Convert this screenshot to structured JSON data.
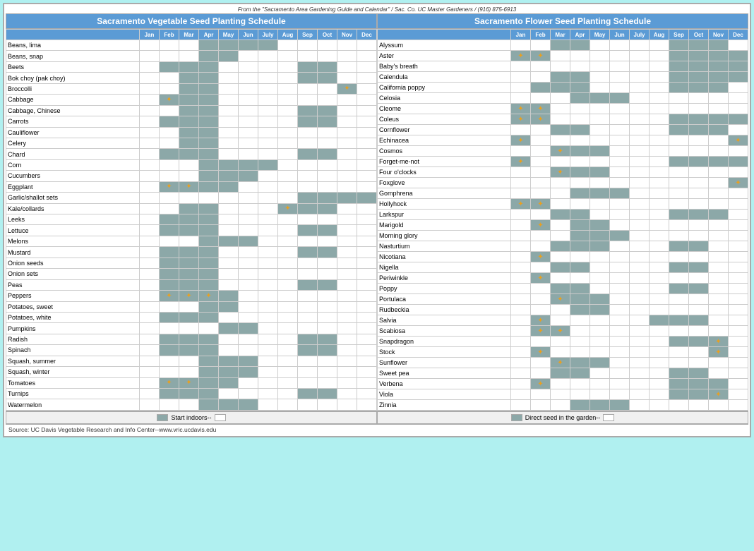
{
  "title": "Sacramento Area Gardening Guide and Calendar",
  "source_header": "From the \"Sacramento Area Gardening Guide and Calendar\" / Sac. Co. UC Master Gardeners / (916) 875-6913",
  "veg_title": "Sacramento Vegetable Seed Planting Schedule",
  "flower_title": "Sacramento Flower Seed Planting Schedule",
  "months": [
    "Jan",
    "Feb",
    "Mar",
    "Apr",
    "May",
    "Jun",
    "July",
    "Aug",
    "Sep",
    "Oct",
    "Nov",
    "Dec"
  ],
  "footer_left": "Start indoors--",
  "footer_right": "Direct seed in the garden--",
  "source_text": "Source:  UC Davis Vegetable Research and Info Center--www.vric.ucdavis.edu",
  "vegetables": [
    {
      "name": "Beans, lima",
      "months": [
        0,
        0,
        0,
        1,
        1,
        1,
        1,
        0,
        0,
        0,
        0,
        0
      ]
    },
    {
      "name": "Beans, snap",
      "months": [
        0,
        0,
        0,
        1,
        1,
        0,
        0,
        0,
        0,
        0,
        0,
        0
      ]
    },
    {
      "name": "Beets",
      "months": [
        0,
        1,
        1,
        1,
        0,
        0,
        0,
        0,
        1,
        1,
        0,
        0
      ]
    },
    {
      "name": "Bok choy (pak choy)",
      "months": [
        0,
        0,
        1,
        1,
        0,
        0,
        0,
        0,
        1,
        1,
        0,
        0
      ]
    },
    {
      "name": "Broccolli",
      "months": [
        0,
        0,
        1,
        1,
        0,
        0,
        0,
        0,
        0,
        0,
        "*",
        0
      ]
    },
    {
      "name": "Cabbage",
      "months": [
        0,
        "*",
        1,
        1,
        0,
        0,
        0,
        0,
        0,
        0,
        0,
        0
      ]
    },
    {
      "name": "Cabbage, Chinese",
      "months": [
        0,
        0,
        1,
        1,
        0,
        0,
        0,
        0,
        1,
        1,
        0,
        0
      ]
    },
    {
      "name": "Carrots",
      "months": [
        0,
        1,
        1,
        1,
        0,
        0,
        0,
        0,
        1,
        1,
        0,
        0
      ]
    },
    {
      "name": "Cauliflower",
      "months": [
        0,
        0,
        1,
        1,
        0,
        0,
        0,
        0,
        0,
        0,
        0,
        0
      ]
    },
    {
      "name": "Celery",
      "months": [
        0,
        0,
        1,
        1,
        0,
        0,
        0,
        0,
        0,
        0,
        0,
        0
      ]
    },
    {
      "name": "Chard",
      "months": [
        0,
        1,
        1,
        1,
        0,
        0,
        0,
        0,
        1,
        1,
        0,
        0
      ]
    },
    {
      "name": "Corn",
      "months": [
        0,
        0,
        0,
        1,
        1,
        1,
        1,
        0,
        0,
        0,
        0,
        0
      ]
    },
    {
      "name": "Cucumbers",
      "months": [
        0,
        0,
        0,
        1,
        1,
        1,
        0,
        0,
        0,
        0,
        0,
        0
      ]
    },
    {
      "name": "Eggplant",
      "months": [
        0,
        "*",
        "*",
        1,
        1,
        0,
        0,
        0,
        0,
        0,
        0,
        0
      ]
    },
    {
      "name": "Garlic/shallot sets",
      "months": [
        0,
        0,
        0,
        0,
        0,
        0,
        0,
        0,
        1,
        1,
        1,
        1
      ]
    },
    {
      "name": "Kale/collards",
      "months": [
        0,
        0,
        1,
        1,
        0,
        0,
        0,
        "*",
        1,
        1,
        0,
        0
      ]
    },
    {
      "name": "Leeks",
      "months": [
        0,
        1,
        1,
        1,
        0,
        0,
        0,
        0,
        0,
        0,
        0,
        0
      ]
    },
    {
      "name": "Lettuce",
      "months": [
        0,
        1,
        1,
        1,
        0,
        0,
        0,
        0,
        1,
        1,
        0,
        0
      ]
    },
    {
      "name": "Melons",
      "months": [
        0,
        0,
        0,
        1,
        1,
        1,
        0,
        0,
        0,
        0,
        0,
        0
      ]
    },
    {
      "name": "Mustard",
      "months": [
        0,
        1,
        1,
        1,
        0,
        0,
        0,
        0,
        1,
        1,
        0,
        0
      ]
    },
    {
      "name": "Onion seeds",
      "months": [
        0,
        1,
        1,
        1,
        0,
        0,
        0,
        0,
        0,
        0,
        0,
        0
      ]
    },
    {
      "name": "Onion sets",
      "months": [
        0,
        1,
        1,
        1,
        0,
        0,
        0,
        0,
        0,
        0,
        0,
        0
      ]
    },
    {
      "name": "Peas",
      "months": [
        0,
        1,
        1,
        1,
        0,
        0,
        0,
        0,
        1,
        1,
        0,
        0
      ]
    },
    {
      "name": "Peppers",
      "months": [
        0,
        "*",
        "*",
        "*",
        1,
        0,
        0,
        0,
        0,
        0,
        0,
        0
      ]
    },
    {
      "name": "Potatoes, sweet",
      "months": [
        0,
        0,
        0,
        1,
        1,
        0,
        0,
        0,
        0,
        0,
        0,
        0
      ]
    },
    {
      "name": "Potatoes, white",
      "months": [
        0,
        1,
        1,
        1,
        0,
        0,
        0,
        0,
        0,
        0,
        0,
        0
      ]
    },
    {
      "name": "Pumpkins",
      "months": [
        0,
        0,
        0,
        0,
        1,
        1,
        0,
        0,
        0,
        0,
        0,
        0
      ]
    },
    {
      "name": "Radish",
      "months": [
        0,
        1,
        1,
        1,
        0,
        0,
        0,
        0,
        1,
        1,
        0,
        0
      ]
    },
    {
      "name": "Spinach",
      "months": [
        0,
        1,
        1,
        1,
        0,
        0,
        0,
        0,
        1,
        1,
        0,
        0
      ]
    },
    {
      "name": "Squash, summer",
      "months": [
        0,
        0,
        0,
        1,
        1,
        1,
        0,
        0,
        0,
        0,
        0,
        0
      ]
    },
    {
      "name": "Squash, winter",
      "months": [
        0,
        0,
        0,
        1,
        1,
        1,
        0,
        0,
        0,
        0,
        0,
        0
      ]
    },
    {
      "name": "Tomatoes",
      "months": [
        0,
        "*",
        "*",
        1,
        1,
        0,
        0,
        0,
        0,
        0,
        0,
        0
      ]
    },
    {
      "name": "Turnips",
      "months": [
        0,
        1,
        1,
        1,
        0,
        0,
        0,
        0,
        1,
        1,
        0,
        0
      ]
    },
    {
      "name": "Watermelon",
      "months": [
        0,
        0,
        0,
        1,
        1,
        1,
        0,
        0,
        0,
        0,
        0,
        0
      ]
    }
  ],
  "flowers": [
    {
      "name": "Alyssum",
      "months": [
        0,
        0,
        1,
        1,
        0,
        0,
        0,
        0,
        1,
        1,
        1,
        0
      ]
    },
    {
      "name": "Aster",
      "months": [
        "*",
        "*",
        0,
        0,
        0,
        0,
        0,
        0,
        1,
        1,
        1,
        1
      ]
    },
    {
      "name": "Baby's breath",
      "months": [
        0,
        0,
        0,
        0,
        0,
        0,
        0,
        0,
        1,
        1,
        1,
        1
      ]
    },
    {
      "name": "Calendula",
      "months": [
        0,
        0,
        1,
        1,
        0,
        0,
        0,
        0,
        1,
        1,
        1,
        1
      ]
    },
    {
      "name": "California poppy",
      "months": [
        0,
        1,
        1,
        1,
        0,
        0,
        0,
        0,
        1,
        1,
        1,
        0
      ]
    },
    {
      "name": "Celosia",
      "months": [
        0,
        0,
        0,
        1,
        1,
        1,
        0,
        0,
        0,
        0,
        0,
        0
      ]
    },
    {
      "name": "Cleome",
      "months": [
        "*",
        "*",
        0,
        0,
        0,
        0,
        0,
        0,
        0,
        0,
        0,
        0
      ]
    },
    {
      "name": "Coleus",
      "months": [
        "*",
        "*",
        0,
        0,
        0,
        0,
        0,
        0,
        1,
        1,
        1,
        1
      ]
    },
    {
      "name": "Cornflower",
      "months": [
        0,
        0,
        1,
        1,
        0,
        0,
        0,
        0,
        1,
        1,
        1,
        0
      ]
    },
    {
      "name": "Echinacea",
      "months": [
        "*",
        0,
        0,
        0,
        0,
        0,
        0,
        0,
        0,
        0,
        0,
        "*"
      ]
    },
    {
      "name": "Cosmos",
      "months": [
        0,
        0,
        "*",
        1,
        1,
        0,
        0,
        0,
        0,
        0,
        0,
        0
      ]
    },
    {
      "name": "Forget-me-not",
      "months": [
        "*",
        0,
        0,
        0,
        0,
        0,
        0,
        0,
        1,
        1,
        1,
        1
      ]
    },
    {
      "name": "Four o'clocks",
      "months": [
        0,
        0,
        "*",
        1,
        1,
        0,
        0,
        0,
        0,
        0,
        0,
        0
      ]
    },
    {
      "name": "Foxglove",
      "months": [
        0,
        0,
        0,
        0,
        0,
        0,
        0,
        0,
        0,
        0,
        0,
        "*"
      ]
    },
    {
      "name": "Gomphrena",
      "months": [
        0,
        0,
        0,
        1,
        1,
        1,
        0,
        0,
        0,
        0,
        0,
        0
      ]
    },
    {
      "name": "Hollyhock",
      "months": [
        "*",
        "*",
        0,
        0,
        0,
        0,
        0,
        0,
        0,
        0,
        0,
        0
      ]
    },
    {
      "name": "Larkspur",
      "months": [
        0,
        0,
        1,
        1,
        0,
        0,
        0,
        0,
        1,
        1,
        1,
        0
      ]
    },
    {
      "name": "Marigold",
      "months": [
        0,
        "*",
        0,
        1,
        1,
        0,
        0,
        0,
        0,
        0,
        0,
        0
      ]
    },
    {
      "name": "Morning glory",
      "months": [
        0,
        0,
        0,
        1,
        1,
        1,
        0,
        0,
        0,
        0,
        0,
        0
      ]
    },
    {
      "name": "Nasturtium",
      "months": [
        0,
        0,
        1,
        1,
        1,
        0,
        0,
        0,
        1,
        1,
        0,
        0
      ]
    },
    {
      "name": "Nicotiana",
      "months": [
        0,
        "*",
        0,
        0,
        0,
        0,
        0,
        0,
        0,
        0,
        0,
        0
      ]
    },
    {
      "name": "Nigella",
      "months": [
        0,
        0,
        1,
        1,
        0,
        0,
        0,
        0,
        1,
        1,
        0,
        0
      ]
    },
    {
      "name": "Periwinkle",
      "months": [
        0,
        "*",
        0,
        0,
        0,
        0,
        0,
        0,
        0,
        0,
        0,
        0
      ]
    },
    {
      "name": "Poppy",
      "months": [
        0,
        0,
        1,
        1,
        0,
        0,
        0,
        0,
        1,
        1,
        0,
        0
      ]
    },
    {
      "name": "Portulaca",
      "months": [
        0,
        0,
        "*",
        1,
        1,
        0,
        0,
        0,
        0,
        0,
        0,
        0
      ]
    },
    {
      "name": "Rudbeckia",
      "months": [
        0,
        0,
        0,
        1,
        1,
        0,
        0,
        0,
        0,
        0,
        0,
        0
      ]
    },
    {
      "name": "Salvia",
      "months": [
        0,
        "*",
        0,
        0,
        0,
        0,
        0,
        1,
        1,
        1,
        0,
        0
      ]
    },
    {
      "name": "Scabiosa",
      "months": [
        0,
        "*",
        "*",
        0,
        0,
        0,
        0,
        0,
        0,
        0,
        0,
        0
      ]
    },
    {
      "name": "Snapdragon",
      "months": [
        0,
        0,
        0,
        0,
        0,
        0,
        0,
        0,
        1,
        1,
        "*",
        0
      ]
    },
    {
      "name": "Stock",
      "months": [
        0,
        "*",
        0,
        0,
        0,
        0,
        0,
        0,
        0,
        0,
        "*",
        0
      ]
    },
    {
      "name": "Sunflower",
      "months": [
        0,
        0,
        "*",
        1,
        1,
        0,
        0,
        0,
        0,
        0,
        0,
        0
      ]
    },
    {
      "name": "Sweet pea",
      "months": [
        0,
        0,
        1,
        1,
        0,
        0,
        0,
        0,
        1,
        1,
        0,
        0
      ]
    },
    {
      "name": "Verbena",
      "months": [
        0,
        "*",
        0,
        0,
        0,
        0,
        0,
        0,
        1,
        1,
        1,
        0
      ]
    },
    {
      "name": "Viola",
      "months": [
        0,
        0,
        0,
        0,
        0,
        0,
        0,
        0,
        1,
        1,
        "*",
        0
      ]
    },
    {
      "name": "Zinnia",
      "months": [
        0,
        0,
        0,
        1,
        1,
        1,
        0,
        0,
        0,
        0,
        0,
        0
      ]
    }
  ]
}
